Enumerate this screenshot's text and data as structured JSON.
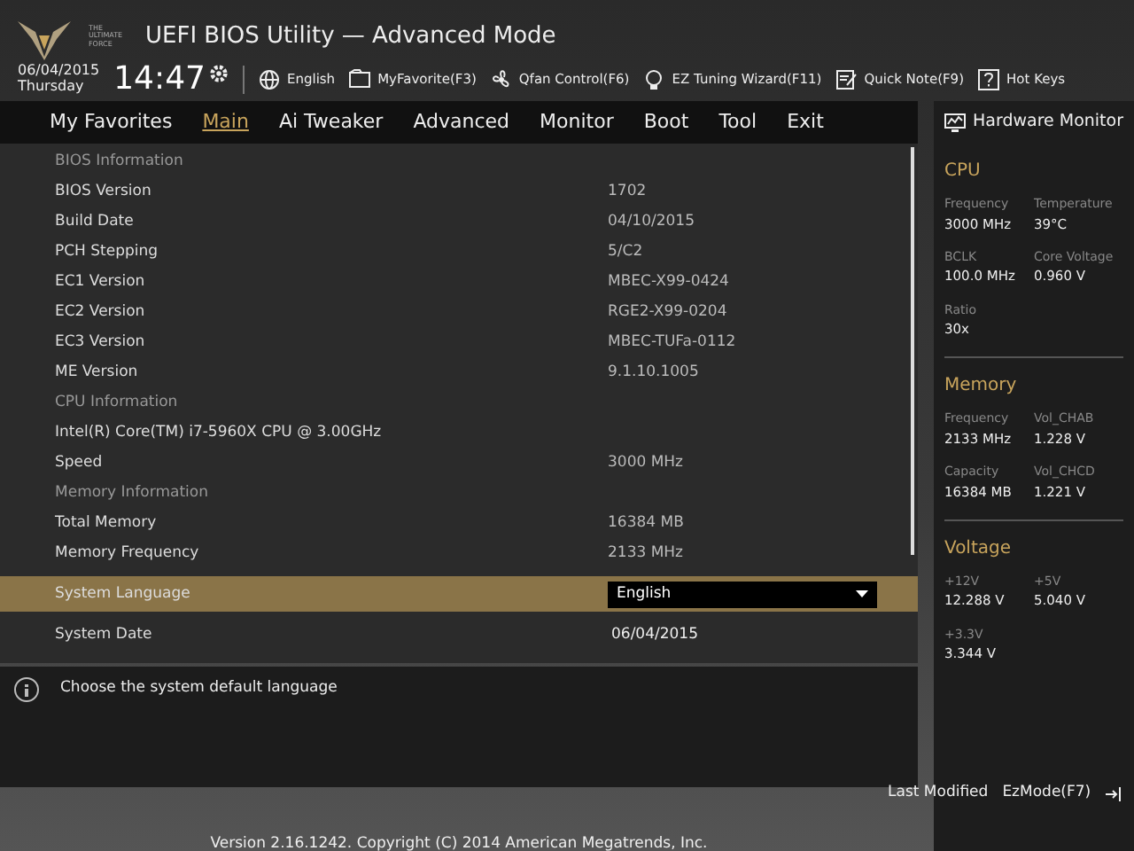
{
  "header": {
    "logo_text": "THE ULTIMATE FORCE",
    "title": "UEFI BIOS Utility — Advanced Mode"
  },
  "clock": {
    "date": "06/04/2015",
    "day": "Thursday",
    "time": "14:47"
  },
  "toolbar": [
    {
      "kind": "globe",
      "label": "English"
    },
    {
      "kind": "favorite",
      "label": "MyFavorite(F3)"
    },
    {
      "kind": "fan",
      "label": "Qfan Control(F6)"
    },
    {
      "kind": "bulb",
      "label": "EZ Tuning Wizard(F11)"
    },
    {
      "kind": "note",
      "label": "Quick Note(F9)"
    },
    {
      "kind": "help",
      "label": "Hot Keys"
    }
  ],
  "tabs": [
    {
      "label": "My Favorites",
      "selected": false
    },
    {
      "label": "Main",
      "selected": true
    },
    {
      "label": "Ai Tweaker",
      "selected": false
    },
    {
      "label": "Advanced",
      "selected": false
    },
    {
      "label": "Monitor",
      "selected": false
    },
    {
      "label": "Boot",
      "selected": false
    },
    {
      "label": "Tool",
      "selected": false
    },
    {
      "label": "Exit",
      "selected": false
    }
  ],
  "rows": [
    {
      "kind": "section",
      "label": "BIOS Information"
    },
    {
      "kind": "info",
      "label": "BIOS Version",
      "value": "1702"
    },
    {
      "kind": "info",
      "label": "Build Date",
      "value": "04/10/2015"
    },
    {
      "kind": "info",
      "label": "PCH Stepping",
      "value": "5/C2"
    },
    {
      "kind": "info",
      "label": "EC1 Version",
      "value": "MBEC-X99-0424"
    },
    {
      "kind": "info",
      "label": "EC2 Version",
      "value": "RGE2-X99-0204"
    },
    {
      "kind": "info",
      "label": "EC3 Version",
      "value": "MBEC-TUFa-0112"
    },
    {
      "kind": "info",
      "label": "ME Version",
      "value": "9.1.10.1005"
    },
    {
      "kind": "section",
      "label": "CPU Information"
    },
    {
      "kind": "info",
      "label": "Intel(R) Core(TM) i7-5960X CPU @ 3.00GHz"
    },
    {
      "kind": "info",
      "label": "Speed",
      "value": "3000 MHz"
    },
    {
      "kind": "section",
      "label": "Memory Information"
    },
    {
      "kind": "info",
      "label": "Total Memory",
      "value": "16384 MB"
    },
    {
      "kind": "info",
      "label": "Memory Frequency",
      "value": "2133 MHz"
    },
    {
      "kind": "select",
      "label": "System Language",
      "value": "English",
      "selected": true
    },
    {
      "kind": "setting",
      "label": "System Date",
      "value": "06/04/2015",
      "selected": false
    }
  ],
  "help_text": "Choose the system default language",
  "hardware_monitor": {
    "title": "Hardware Monitor",
    "groups": [
      {
        "title": "CPU",
        "items": [
          {
            "label": "Frequency",
            "value": "3000 MHz"
          },
          {
            "label": "Temperature",
            "value": "39°C"
          },
          {
            "label": "BCLK",
            "value": "100.0 MHz"
          },
          {
            "label": "Core Voltage",
            "value": "0.960 V"
          },
          {
            "label": "Ratio",
            "value": "30x"
          }
        ]
      },
      {
        "title": "Memory",
        "items": [
          {
            "label": "Frequency",
            "value": "2133 MHz"
          },
          {
            "label": "Vol_CHAB",
            "value": "1.228 V"
          },
          {
            "label": "Capacity",
            "value": "16384 MB"
          },
          {
            "label": "Vol_CHCD",
            "value": "1.221 V"
          }
        ]
      },
      {
        "title": "Voltage",
        "items": [
          {
            "label": "+12V",
            "value": "12.288 V"
          },
          {
            "label": "+5V",
            "value": "5.040 V"
          },
          {
            "label": "+3.3V",
            "value": "3.344 V"
          }
        ]
      }
    ]
  },
  "footer": {
    "last_modified": "Last Modified",
    "ez_mode": "EzMode(F7)",
    "copyright": "Version 2.16.1242. Copyright (C) 2014 American Megatrends, Inc."
  }
}
